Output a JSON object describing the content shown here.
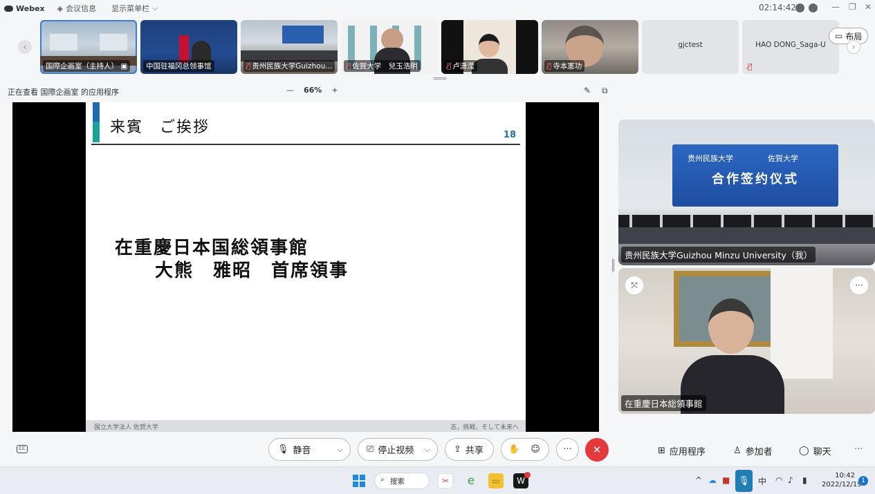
{
  "titlebar": {
    "app_name": "Webex",
    "meeting_info": "会议信息",
    "show_menu": "显示菜单栏",
    "clock": "02:14:42"
  },
  "participants": [
    {
      "name": "国際企画室（主持人）",
      "muted": false,
      "host": true
    },
    {
      "name": "中国驻福冈总领事馆",
      "muted": false
    },
    {
      "name": "贵州民族大学Guizhou...",
      "muted": true
    },
    {
      "name": "佐賀大学　兒玉浩明",
      "muted": true
    },
    {
      "name": "卢潇滢",
      "muted": true
    },
    {
      "name": "寺本憲功",
      "muted": true
    },
    {
      "name": "gjctest",
      "muted": false
    },
    {
      "name": "HAO DONG_Saga-U",
      "muted": true
    }
  ],
  "layout_button": "布局",
  "sharebar": {
    "viewing_text": "正在查看 国際企画室 的应用程序",
    "zoom_minus": "—",
    "zoom_value": "66%",
    "zoom_plus": "+"
  },
  "slide": {
    "title": "来賓　ご挨拶",
    "page_number": "18",
    "line1": "在重慶日本国総領事館",
    "line2": "　大熊　雅昭　首席領事",
    "footer_left": "国立大学法人 佐賀大学",
    "footer_right": "志，挑戦，そして未来へ"
  },
  "videos": {
    "self_name": "贵州民族大学Guizhou Minzu University（我）",
    "self_banner_left": "贵州民族大学",
    "self_banner_right": "佐賀大学",
    "self_banner_title": "合作签约仪式",
    "speaker_name": "在重慶日本総領事館"
  },
  "controls": {
    "mute": "静音",
    "stop_video": "停止视频",
    "share": "共享",
    "apps": "应用程序",
    "participants": "参加者",
    "chat": "聊天",
    "more": "···"
  },
  "taskbar": {
    "search": "搜索",
    "time": "10:42",
    "date": "2022/12/19",
    "notification_count": "1"
  },
  "colors": {
    "end_call": "#e5383b",
    "accent": "#3a7bd5",
    "slide_blue": "#1f6ab0",
    "slide_teal": "#19a39b"
  }
}
